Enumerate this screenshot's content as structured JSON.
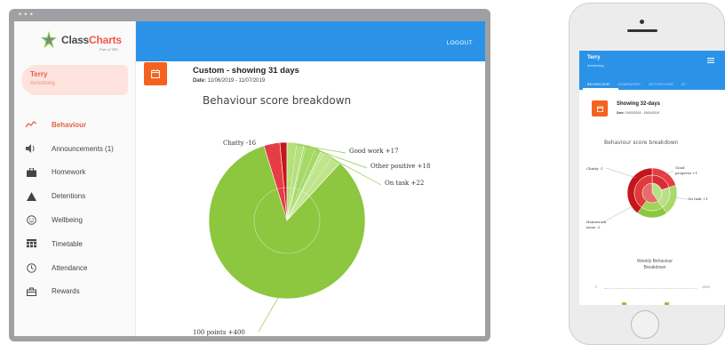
{
  "desktop": {
    "logo": {
      "text_main": "Class",
      "text_accent": "Charts",
      "sub": "Part of TBD"
    },
    "user": {
      "first_name": "Terry",
      "last_name": "Armstrong"
    },
    "nav": [
      {
        "label": "Behaviour",
        "icon": "trend-line-icon",
        "active": true
      },
      {
        "label": "Announcements (1)",
        "icon": "speaker-icon",
        "active": false
      },
      {
        "label": "Homework",
        "icon": "briefcase-icon",
        "active": false
      },
      {
        "label": "Detentions",
        "icon": "warning-triangle-icon",
        "active": false
      },
      {
        "label": "Wellbeing",
        "icon": "smiley-icon",
        "active": false
      },
      {
        "label": "Timetable",
        "icon": "calendar-grid-icon",
        "active": false
      },
      {
        "label": "Attendance",
        "icon": "clock-icon",
        "active": false
      },
      {
        "label": "Rewards",
        "icon": "gift-bag-icon",
        "active": false
      }
    ],
    "logout_label": "LOGOUT",
    "date": {
      "title": "Custom - showing 31 days",
      "range_label": "Date:",
      "range": "11/06/2019 - 11/07/2019"
    },
    "chart_title": "Behaviour score breakdown"
  },
  "phone": {
    "user": {
      "first_name": "Terry",
      "last_name": "Armstrong"
    },
    "tabs": [
      "BEHAVIOUR",
      "HOMEWORK",
      "DETENTIONS",
      "AT"
    ],
    "date": {
      "title": "Showing 32-days",
      "range_label": "Date:",
      "range": "19/03/2019 - 19/04/2019"
    },
    "chart_title": "Behaviour score breakdown",
    "labels": {
      "chatty": "Chatty -1",
      "good_progress_1": "Good",
      "good_progress_2": "progress +1",
      "on_task": "On task +1",
      "homework_1": "Homework",
      "homework_2": "issue -2"
    },
    "weekly_title_1": "Weekly Behaviour",
    "weekly_title_2": "Breakdown",
    "axis_left": "2",
    "axis_right": "100%"
  },
  "colors": {
    "brand_blue": "#2a93e8",
    "accent_orange": "#f5611e",
    "positive_green": "#8dc63f",
    "light_green": "#a8d96a",
    "negative_red": "#e63c46",
    "dark_red": "#c4161c",
    "active_red_text": "#e4604a"
  },
  "chart_data": [
    {
      "type": "pie",
      "title": "Behaviour score breakdown",
      "slices": [
        {
          "label": "100 points +400",
          "value": 400,
          "color": "#8dc63f"
        },
        {
          "label": "Chatty -16",
          "value": 16,
          "color": "#e63c46"
        },
        {
          "label": "",
          "value": 7,
          "color": "#c4161c"
        },
        {
          "label": "Good work +17",
          "value": 17,
          "color": "#8dc63f"
        },
        {
          "label": "Other positive +18",
          "value": 18,
          "color": "#8dc63f"
        },
        {
          "label": "On task +22",
          "value": 22,
          "color": "#8dc63f"
        }
      ],
      "legend": "none"
    },
    {
      "type": "pie",
      "title": "Behaviour score breakdown",
      "slices": [
        {
          "label": "Chatty -1",
          "value": 1,
          "color": "#e63c46"
        },
        {
          "label": "Good progress +1",
          "value": 1,
          "color": "#8dc63f"
        },
        {
          "label": "On task +1",
          "value": 1,
          "color": "#8dc63f"
        },
        {
          "label": "Homework issue -2",
          "value": 2,
          "color": "#c4161c"
        }
      ],
      "legend": "none"
    }
  ]
}
